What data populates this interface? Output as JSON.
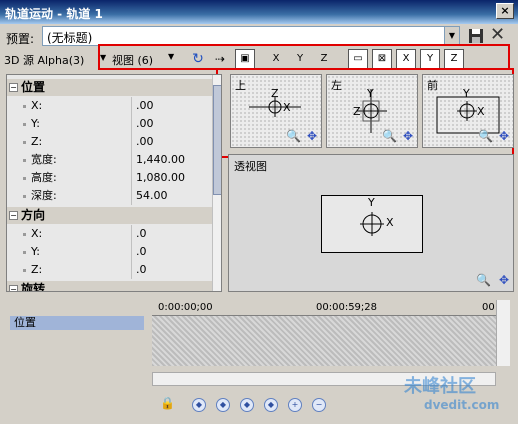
{
  "window": {
    "title": "轨道运动 - 轨道 1",
    "close_label": "×"
  },
  "preset": {
    "label": "预置:",
    "value": "(无标题)"
  },
  "toolbar": {
    "source_label": "3D 源 Alpha(3)",
    "view_label": "视图 (6)",
    "axis_buttons": [
      "X",
      "Y",
      "Z"
    ],
    "view_axis_buttons": [
      "X",
      "Y",
      "Z"
    ]
  },
  "properties": {
    "groups": [
      {
        "title": "位置",
        "rows": [
          {
            "name": "X:",
            "value": ".00"
          },
          {
            "name": "Y:",
            "value": ".00"
          },
          {
            "name": "Z:",
            "value": ".00"
          },
          {
            "name": "宽度:",
            "value": "1,440.00"
          },
          {
            "name": "高度:",
            "value": "1,080.00"
          },
          {
            "name": "深度:",
            "value": "54.00"
          }
        ]
      },
      {
        "title": "方向",
        "rows": [
          {
            "name": "X:",
            "value": ".0"
          },
          {
            "name": "Y:",
            "value": ".0"
          },
          {
            "name": "Z:",
            "value": ".0"
          }
        ]
      },
      {
        "title": "旋转",
        "rows": []
      }
    ]
  },
  "viewports": [
    {
      "label": "上",
      "axis_a": "Z",
      "axis_b": "X"
    },
    {
      "label": "左",
      "axis_a": "Y",
      "axis_b": "Z"
    },
    {
      "label": "前",
      "axis_a": "Y",
      "axis_b": "X"
    }
  ],
  "perspective": {
    "label": "透视图",
    "axis_y": "Y",
    "axis_x": "X"
  },
  "timeline": {
    "track_label": "位置",
    "time_start": "0:00:00;00",
    "time_mid": "00:00:59;28",
    "time_end": "00"
  },
  "watermark": {
    "text": "未峰社区",
    "sub": "dvedit.com"
  }
}
